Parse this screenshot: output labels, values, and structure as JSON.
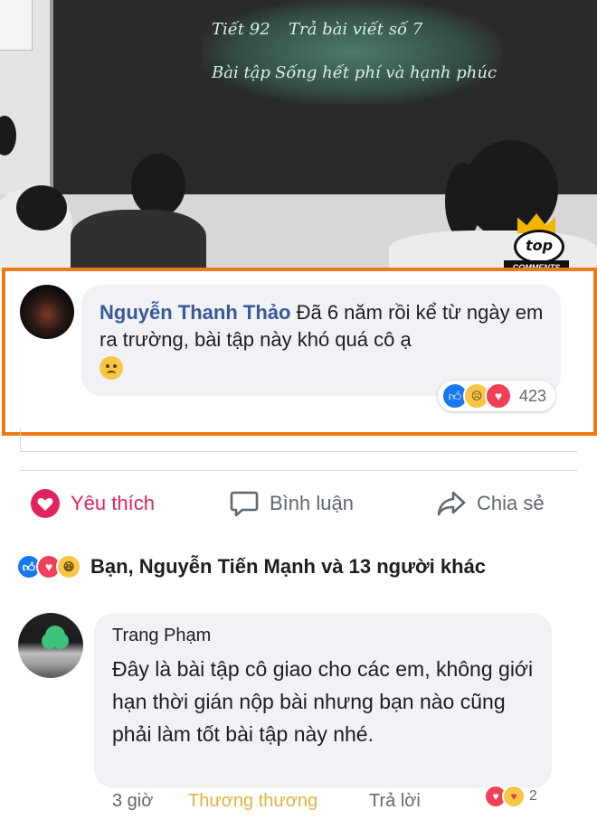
{
  "photo": {
    "board_lines": [
      "Tiết 92",
      "Trả bài viết số 7",
      "Bài tập",
      "Sống hết phí và hạnh phúc"
    ],
    "badge": {
      "top_text": "top",
      "ribbon_text": "COMMENTS"
    }
  },
  "highlighted_comment": {
    "author": "Nguyễn Thanh Thảo",
    "text": "Đã 6 năm rồi kể từ ngày em ra trường, bài tập này khó quá cô ạ",
    "reactions": [
      "like",
      "sad",
      "love"
    ],
    "reaction_count": "423",
    "highlight_color": "#f07a12"
  },
  "actions": {
    "like_label": "Yêu thích",
    "comment_label": "Bình luận",
    "share_label": "Chia sẻ"
  },
  "post_reactions": {
    "icons": [
      "like",
      "love",
      "haha"
    ],
    "summary": "Bạn, Nguyễn Tiến Mạnh và 13 người khác"
  },
  "reply_comment": {
    "author": "Trang Phạm",
    "text": "Đây là bài tập cô giao cho các em, không giới hạn thời gián nộp bài nhưng bạn nào cũng phải làm tốt bài tập này nhé.",
    "time": "3 giờ",
    "reacted_label": "Thương thương",
    "reply_label": "Trả lời",
    "reactions": [
      "love",
      "care"
    ],
    "reaction_count": "2"
  },
  "colors": {
    "name_blue": "#385898",
    "like_red": "#e0245e",
    "care_gold": "#e2b43d"
  }
}
